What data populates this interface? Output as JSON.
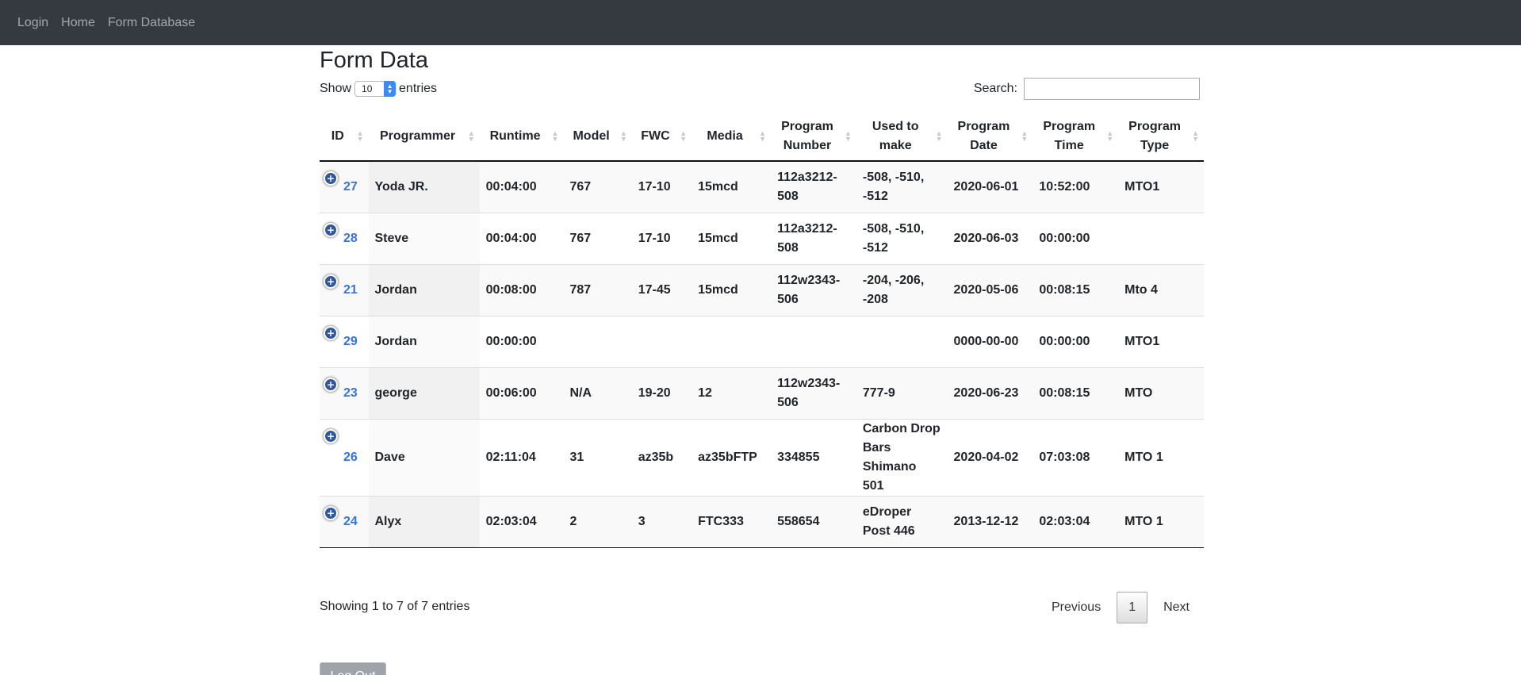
{
  "nav": {
    "items": [
      "Login",
      "Home",
      "Form Database"
    ]
  },
  "page": {
    "title": "Form Data"
  },
  "length": {
    "show_label": "Show",
    "value": "10",
    "entries_label": "entries"
  },
  "search": {
    "label": "Search:",
    "value": ""
  },
  "table": {
    "headers": [
      "ID",
      "Programmer",
      "Runtime",
      "Model",
      "FWC",
      "Media",
      "Program Number",
      "Used to make",
      "Program Date",
      "Program Time",
      "Program Type"
    ],
    "rows": [
      [
        "27",
        "Yoda JR.",
        "00:04:00",
        "767",
        "17-10",
        "15mcd",
        "112a3212-508",
        "-508, -510, -512",
        "2020-06-01",
        "10:52:00",
        "MTO1"
      ],
      [
        "28",
        "Steve",
        "00:04:00",
        "767",
        "17-10",
        "15mcd",
        "112a3212-508",
        "-508, -510, -512",
        "2020-06-03",
        "00:00:00",
        ""
      ],
      [
        "21",
        "Jordan",
        "00:08:00",
        "787",
        "17-45",
        "15mcd",
        "112w2343-506",
        "-204, -206, -208",
        "2020-05-06",
        "00:08:15",
        "Mto 4"
      ],
      [
        "29",
        "Jordan",
        "00:00:00",
        "",
        "",
        "",
        "",
        "",
        "0000-00-00",
        "00:00:00",
        "MTO1"
      ],
      [
        "23",
        "george",
        "00:06:00",
        "N/A",
        "19-20",
        "12",
        "112w2343-506",
        "777-9",
        "2020-06-23",
        "00:08:15",
        "MTO"
      ],
      [
        "26",
        "Dave",
        "02:11:04",
        "31",
        "az35b",
        "az35bFTP",
        "334855",
        "Carbon Drop Bars Shimano 501",
        "2020-04-02",
        "07:03:08",
        "MTO 1"
      ],
      [
        "24",
        "Alyx",
        "02:03:04",
        "2",
        "3",
        "FTC333",
        "558654",
        "eDroper Post 446",
        "2013-12-12",
        "02:03:04",
        "MTO 1"
      ]
    ]
  },
  "info": "Showing 1 to 7 of 7 entries",
  "pagination": {
    "previous": "Previous",
    "current": "1",
    "next": "Next"
  },
  "logout_label": "Log Out"
}
